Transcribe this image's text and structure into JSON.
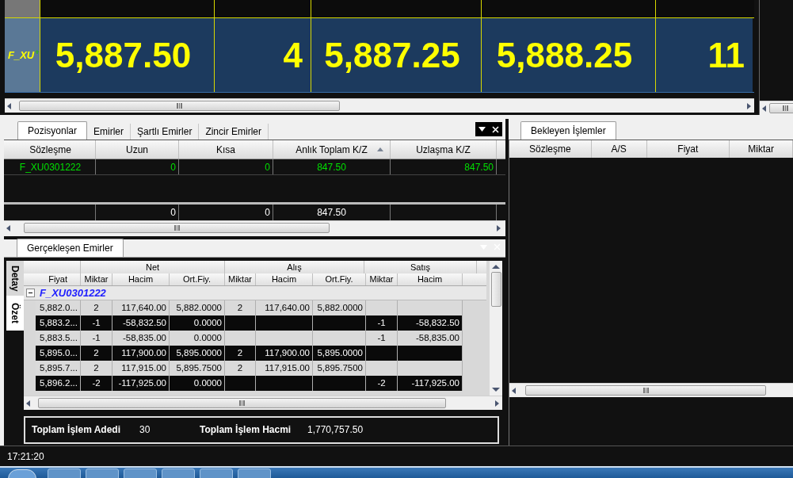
{
  "ticker": {
    "symbol": "F_XU",
    "values": [
      "5,887.50",
      "4",
      "5,887.25",
      "5,888.25",
      "11"
    ]
  },
  "positions": {
    "tabs": [
      {
        "label": "Pozisyonlar",
        "selected": true
      },
      {
        "label": "Emirler",
        "selected": false
      },
      {
        "label": "Şartlı Emirler",
        "selected": false
      },
      {
        "label": "Zincir Emirler",
        "selected": false
      }
    ],
    "columns": [
      {
        "label": "Sözleşme",
        "sorted": false
      },
      {
        "label": "Uzun",
        "sorted": false
      },
      {
        "label": "Kısa",
        "sorted": false
      },
      {
        "label": "Anlık Toplam K/Z",
        "sorted": true
      },
      {
        "label": "Uzlaşma K/Z",
        "sorted": false
      }
    ],
    "rows": [
      {
        "cells": [
          "F_XU0301222",
          "0",
          "0",
          "847.50",
          "847.50"
        ]
      }
    ],
    "totals": [
      "0",
      "0",
      "847.50"
    ]
  },
  "pending": {
    "tab": {
      "label": "Bekleyen İşlemler",
      "selected": true
    },
    "columns": [
      "Sözleşme",
      "A/S",
      "Fiyat",
      "Miktar"
    ]
  },
  "executions": {
    "tab": {
      "label": "Gerçekleşen Emirler",
      "selected": true
    },
    "side_tabs": [
      {
        "label": "Detay",
        "selected": false
      },
      {
        "label": "Özet",
        "selected": true
      }
    ],
    "groups": [
      "Net",
      "Alış",
      "Satış"
    ],
    "columns": [
      "Fiyat",
      "Miktar",
      "Hacim",
      "Ort.Fiy.",
      "Miktar",
      "Hacim",
      "Ort.Fiy.",
      "Miktar",
      "Hacim"
    ],
    "group_row": {
      "label": "F_XU0301222",
      "expanded": true
    },
    "rows": [
      {
        "cells": [
          "5,882.0...",
          "2",
          "117,640.00",
          "5,882.0000",
          "2",
          "117,640.00",
          "5,882.0000",
          null,
          null
        ]
      },
      {
        "cells": [
          "5,883.2...",
          "-1",
          "-58,832.50",
          "0.0000",
          null,
          null,
          null,
          "-1",
          "-58,832.50"
        ]
      },
      {
        "cells": [
          "5,883.5...",
          "-1",
          "-58,835.00",
          "0.0000",
          null,
          null,
          null,
          "-1",
          "-58,835.00"
        ]
      },
      {
        "cells": [
          "5,895.0...",
          "2",
          "117,900.00",
          "5,895.0000",
          "2",
          "117,900.00",
          "5,895.0000",
          null,
          null
        ]
      },
      {
        "cells": [
          "5,895.7...",
          "2",
          "117,915.00",
          "5,895.7500",
          "2",
          "117,915.00",
          "5,895.7500",
          null,
          null
        ]
      },
      {
        "cells": [
          "5,896.2...",
          "-2",
          "-117,925.00",
          "0.0000",
          null,
          null,
          null,
          "-2",
          "-117,925.00"
        ]
      }
    ]
  },
  "summary": [
    {
      "label": "Toplam İşlem Adedi",
      "value": "30"
    },
    {
      "label": "Toplam İşlem Hacmi",
      "value": "1,770,757.50"
    }
  ],
  "status_bar": {
    "time": "17:21:20"
  }
}
